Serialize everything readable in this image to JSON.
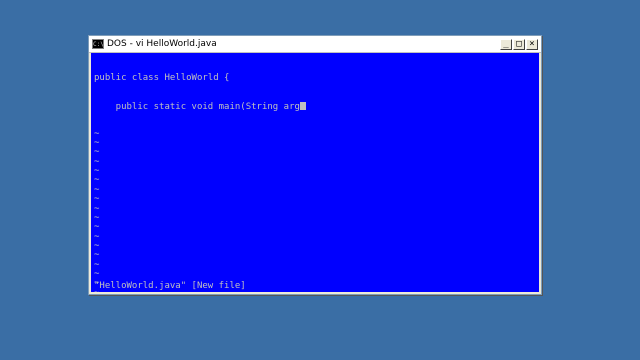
{
  "window": {
    "title": "DOS - vi HelloWorld.java",
    "icon_text": "C:\\",
    "minimize_label": "_",
    "maximize_label": "□",
    "close_label": "×"
  },
  "editor": {
    "lines": [
      "public class HelloWorld {",
      "    public static void main(String arg"
    ],
    "tilde": "~",
    "tilde_count": 21,
    "status": "\"HelloWorld.java\" [New file]"
  },
  "colors": {
    "desktop": "#3a6ea5",
    "console_bg": "#0000ff",
    "console_fg": "#c0c0c0"
  }
}
